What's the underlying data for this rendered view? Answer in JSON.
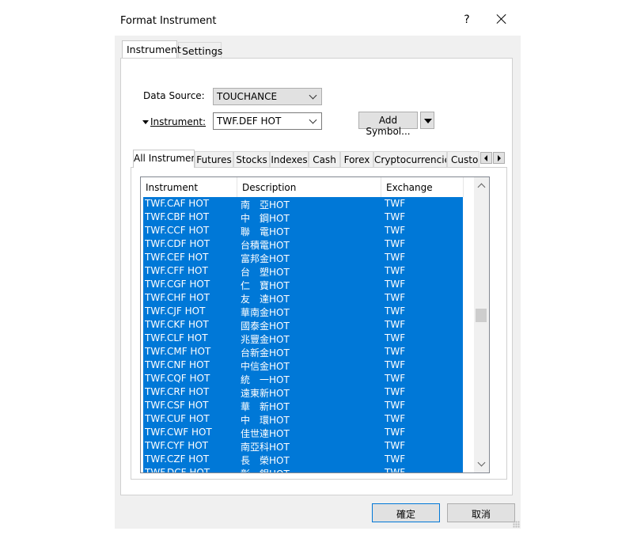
{
  "window": {
    "title": "Format Instrument",
    "help_label": "?",
    "close_icon": "close-icon"
  },
  "tabs": [
    {
      "label": "Instrument",
      "active": true
    },
    {
      "label": "Settings",
      "active": false
    }
  ],
  "form": {
    "data_source_label": "Data Source:",
    "data_source_value": "TOUCHANCE",
    "instrument_label": "Instrument:",
    "instrument_value": "TWF.DEF HOT",
    "add_symbol_label": "Add Symbol..."
  },
  "instrument_tabs": [
    "All Instruments",
    "Futures",
    "Stocks",
    "Indexes",
    "Cash",
    "Forex",
    "Cryptocurrencies",
    "Custom"
  ],
  "list": {
    "columns": [
      "Instrument",
      "Description",
      "Exchange"
    ],
    "rows": [
      [
        "TWF.CAF HOT",
        "南　亞HOT",
        "TWF"
      ],
      [
        "TWF.CBF HOT",
        "中　鋼HOT",
        "TWF"
      ],
      [
        "TWF.CCF HOT",
        "聯　電HOT",
        "TWF"
      ],
      [
        "TWF.CDF HOT",
        "台積電HOT",
        "TWF"
      ],
      [
        "TWF.CEF HOT",
        "富邦金HOT",
        "TWF"
      ],
      [
        "TWF.CFF HOT",
        "台　塑HOT",
        "TWF"
      ],
      [
        "TWF.CGF HOT",
        "仁　寶HOT",
        "TWF"
      ],
      [
        "TWF.CHF HOT",
        "友　達HOT",
        "TWF"
      ],
      [
        "TWF.CJF HOT",
        "華南金HOT",
        "TWF"
      ],
      [
        "TWF.CKF HOT",
        "國泰金HOT",
        "TWF"
      ],
      [
        "TWF.CLF HOT",
        "兆豐金HOT",
        "TWF"
      ],
      [
        "TWF.CMF HOT",
        "台新金HOT",
        "TWF"
      ],
      [
        "TWF.CNF HOT",
        "中信金HOT",
        "TWF"
      ],
      [
        "TWF.CQF HOT",
        "統　一HOT",
        "TWF"
      ],
      [
        "TWF.CRF HOT",
        "遠東新HOT",
        "TWF"
      ],
      [
        "TWF.CSF HOT",
        "華　新HOT",
        "TWF"
      ],
      [
        "TWF.CUF HOT",
        "中　環HOT",
        "TWF"
      ],
      [
        "TWF.CWF HOT",
        "佳世達HOT",
        "TWF"
      ],
      [
        "TWF.CYF HOT",
        "南亞科HOT",
        "TWF"
      ],
      [
        "TWF.CZF HOT",
        "長　榮HOT",
        "TWF"
      ],
      [
        "TWF.DCF HOT",
        "彰　銀HOT",
        "TWF"
      ]
    ],
    "selection_color": "#0078d7"
  },
  "footer": {
    "ok_label": "確定",
    "cancel_label": "取消"
  }
}
